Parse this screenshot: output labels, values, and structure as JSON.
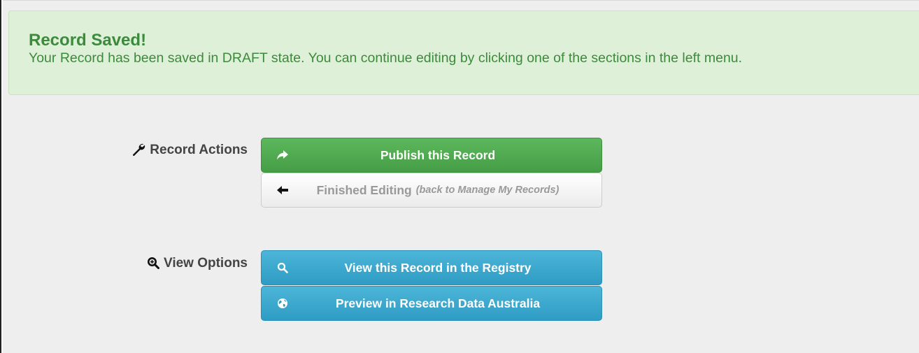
{
  "alert": {
    "title": "Record Saved!",
    "message": "Your Record has been saved in DRAFT state. You can continue editing by clicking one of the sections in the left menu."
  },
  "record_actions": {
    "label": "Record Actions",
    "icon": "wrench-icon",
    "publish": {
      "label": "Publish this Record",
      "icon": "share-arrow-icon",
      "color": "#5cb85c"
    },
    "finished": {
      "label": "Finished Editing",
      "sublabel": "(back to Manage My Records)",
      "icon": "arrow-left-icon"
    }
  },
  "view_options": {
    "label": "View Options",
    "icon": "zoom-search-icon",
    "view_registry": {
      "label": "View this Record in the Registry",
      "icon": "search-icon",
      "color": "#2f9cc4"
    },
    "preview_rda": {
      "label": "Preview in Research Data Australia",
      "icon": "globe-icon",
      "color": "#2f9cc4"
    }
  }
}
